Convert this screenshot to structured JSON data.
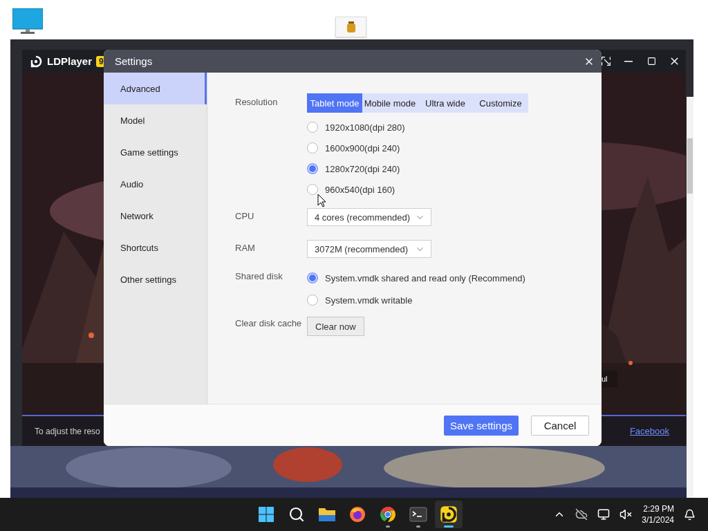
{
  "emulator": {
    "title": "LDPlayer",
    "version_badge": "9",
    "overlay_text": "ul",
    "notice": "To adjust the reso",
    "link": "Facebook"
  },
  "settings": {
    "title": "Settings",
    "nav": [
      {
        "label": "Advanced",
        "selected": true
      },
      {
        "label": "Model",
        "selected": false
      },
      {
        "label": "Game settings",
        "selected": false
      },
      {
        "label": "Audio",
        "selected": false
      },
      {
        "label": "Network",
        "selected": false
      },
      {
        "label": "Shortcuts",
        "selected": false
      },
      {
        "label": "Other settings",
        "selected": false
      }
    ],
    "resolution": {
      "label": "Resolution",
      "modes": [
        {
          "label": "Tablet mode",
          "selected": true
        },
        {
          "label": "Mobile mode",
          "selected": false
        },
        {
          "label": "Ultra wide",
          "selected": false
        },
        {
          "label": "Customize",
          "selected": false
        }
      ],
      "options": [
        {
          "label": "1920x1080(dpi 280)",
          "selected": false
        },
        {
          "label": "1600x900(dpi 240)",
          "selected": false
        },
        {
          "label": "1280x720(dpi 240)",
          "selected": true
        },
        {
          "label": "960x540(dpi 160)",
          "selected": false
        }
      ]
    },
    "cpu": {
      "label": "CPU",
      "value": "4 cores (recommended)"
    },
    "ram": {
      "label": "RAM",
      "value": "3072M (recommended)"
    },
    "shared_disk": {
      "label": "Shared disk",
      "options": [
        {
          "label": "System.vmdk shared and read only (Recommend)",
          "selected": true
        },
        {
          "label": "System.vmdk writable",
          "selected": false
        }
      ]
    },
    "disk_cache": {
      "label": "Clear disk cache",
      "button": "Clear now"
    },
    "buttons": [
      {
        "label": "Save settings",
        "kind": "primary"
      },
      {
        "label": "Cancel",
        "kind": "secondary"
      }
    ]
  },
  "taskbar": {
    "apps": [
      {
        "kind": "start",
        "running": false,
        "active": false
      },
      {
        "kind": "search",
        "running": false,
        "active": false
      },
      {
        "kind": "folder",
        "running": false,
        "active": false
      },
      {
        "kind": "firefox",
        "running": false,
        "active": false
      },
      {
        "kind": "chrome",
        "running": true,
        "active": false
      },
      {
        "kind": "terminal",
        "running": true,
        "active": false
      },
      {
        "kind": "ldplayer",
        "running": true,
        "active": true
      }
    ],
    "time": "2:29 PM",
    "date": "3/1/2024"
  }
}
